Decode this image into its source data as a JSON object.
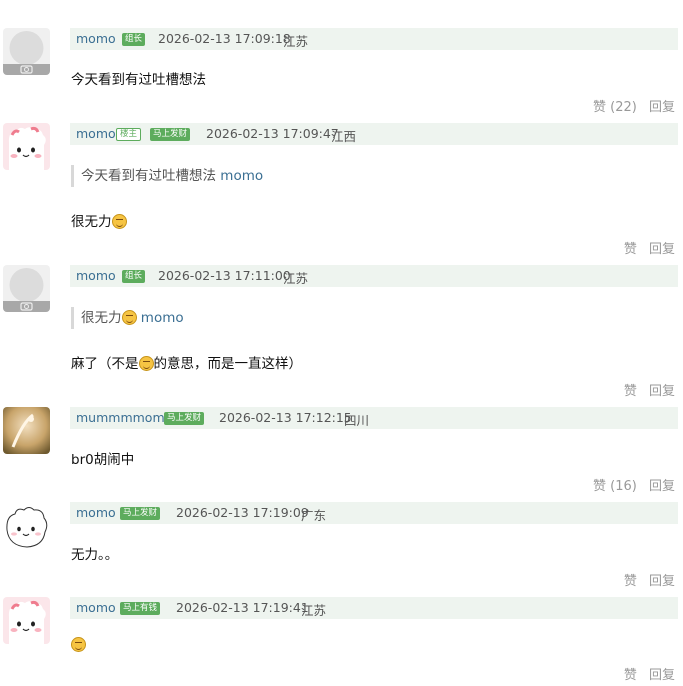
{
  "comments": [
    {
      "username": "momo",
      "badges": [
        {
          "text": "组长",
          "style": "filled"
        }
      ],
      "time": "2026-02-13 17:09:18",
      "location": "江苏",
      "text": "今天看到有过吐槽想法",
      "like_label": "赞",
      "like_count": "(22)",
      "reply_label": "回复",
      "avatar": "default-avatar-icon"
    },
    {
      "username": "momo",
      "badges": [
        {
          "text": "楼主",
          "style": "outline"
        },
        {
          "text": "马上发财",
          "style": "filled"
        }
      ],
      "time": "2026-02-13 17:09:47",
      "location": "江西",
      "quote_text": "今天看到有过吐槽想法",
      "quote_author": "momo",
      "text": "很无力",
      "like_label": "赞",
      "like_count": "",
      "reply_label": "回复",
      "avatar": "pink-creature-avatar"
    },
    {
      "username": "momo",
      "badges": [
        {
          "text": "组长",
          "style": "filled"
        }
      ],
      "time": "2026-02-13 17:11:00",
      "location": "江苏",
      "quote_text": "很无力",
      "quote_author": "momo",
      "text_before": "麻了（不是",
      "text_after": "的意思，而是一直这样）",
      "like_label": "赞",
      "like_count": "",
      "reply_label": "回复",
      "avatar": "default-avatar-icon"
    },
    {
      "username": "mummmmom",
      "badges": [
        {
          "text": "马上发财",
          "style": "filled"
        }
      ],
      "time": "2026-02-13 17:12:15",
      "location": "四川",
      "text": "br0胡闹中",
      "like_label": "赞",
      "like_count": "(16)",
      "reply_label": "回复",
      "avatar": "photo-avatar"
    },
    {
      "username": "momo",
      "badges": [
        {
          "text": "马上发财",
          "style": "filled"
        }
      ],
      "time": "2026-02-13 17:19:09",
      "location": "广东",
      "text": "无力。。",
      "like_label": "赞",
      "like_count": "",
      "reply_label": "回复",
      "avatar": "white-creature-avatar"
    },
    {
      "username": "momo",
      "badges": [
        {
          "text": "马上有钱",
          "style": "filled"
        }
      ],
      "time": "2026-02-13 17:19:41",
      "location": "江苏",
      "text": "",
      "like_label": "赞",
      "like_count": "",
      "reply_label": "回复",
      "avatar": "pink-creature-avatar"
    }
  ]
}
